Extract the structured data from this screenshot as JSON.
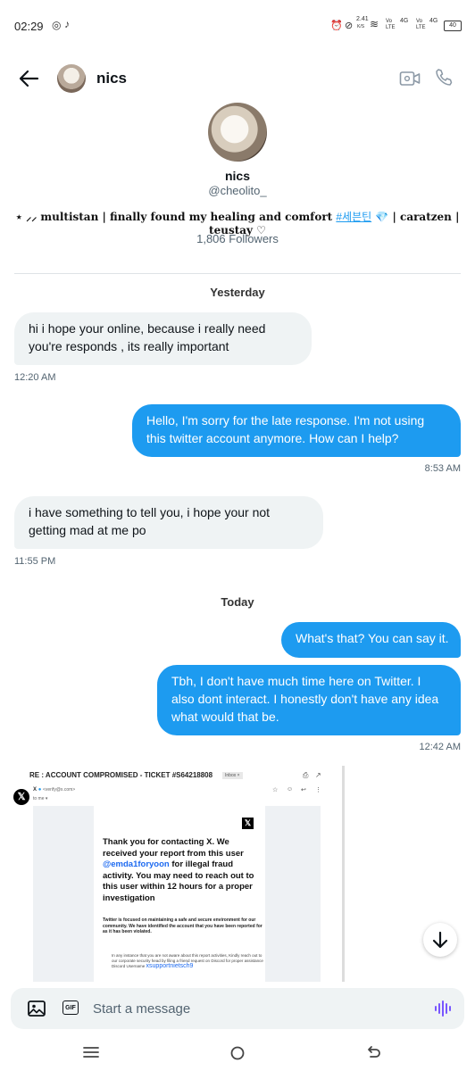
{
  "status_bar": {
    "time": "02:29",
    "speed": "2.41",
    "speed_unit": "K/S",
    "net1": "Vo LTE",
    "net2": "4G",
    "net3": "Vo LTE",
    "net4": "4G",
    "battery": "40"
  },
  "header": {
    "name": "nics",
    "icons": [
      "back-arrow-icon",
      "video-call-icon",
      "phone-icon"
    ]
  },
  "profile": {
    "name": "nics",
    "handle": "@cheolito_",
    "bio_prefix": "⋆ ⸝⸝ multistan | finally found my healing and comfort ",
    "bio_hashtag": "#세븐틴",
    "bio_suffix": " 💎 | caratzen | teustay ♡",
    "followers": "1,806 Followers"
  },
  "conversation": {
    "day1": "Yesterday",
    "day2": "Today",
    "messages": [
      {
        "dir": "in",
        "text": "hi i hope your online, because i really need you're responds , its really important",
        "time": "12:20 AM"
      },
      {
        "dir": "out",
        "text": "Hello, I'm sorry for the late response. I'm not using this twitter account anymore. How can I help?",
        "time": "8:53 AM"
      },
      {
        "dir": "in",
        "text": "i have something to tell you, i hope your not getting mad at me po",
        "time": "11:55 PM"
      },
      {
        "dir": "out",
        "text": "What's that? You can say it.",
        "time": ""
      },
      {
        "dir": "out",
        "text": "Tbh, I don't have much time here on Twitter. I also dont interact. I honestly don't have any idea what would that be.",
        "time": "12:42 AM"
      }
    ]
  },
  "attachment": {
    "subject": "RE : ACCOUNT COMPROMISED - TICKET #S64218808",
    "inbox_tag": "Inbox ×",
    "sender": "X",
    "sender_email": "<verify@x.com>",
    "to": "to me ▾",
    "body_1": "Thank you for contacting X. We received your report from this user ",
    "body_user": "@emda1foryoon",
    "body_2": " for illegal fraud activity. You may need to reach out to this user within 12 hours for a proper investigation",
    "body_para": "Twitter is focused on maintaining a safe and secure environment for our community. We have identified the account that you have been reported for as it has been violated.",
    "body_small_1": "In any instance that you are not aware about this report activities, Kindly reach out to our corporate security head by filing a friend request on Discord for proper assistance Discord Username",
    "body_discord": "xsupportnietsch9"
  },
  "composer": {
    "placeholder": "Start a message"
  },
  "colors": {
    "accent": "#1d9bf0",
    "incoming_bubble": "#eff3f4",
    "text": "#0f1419",
    "muted": "#536471"
  }
}
